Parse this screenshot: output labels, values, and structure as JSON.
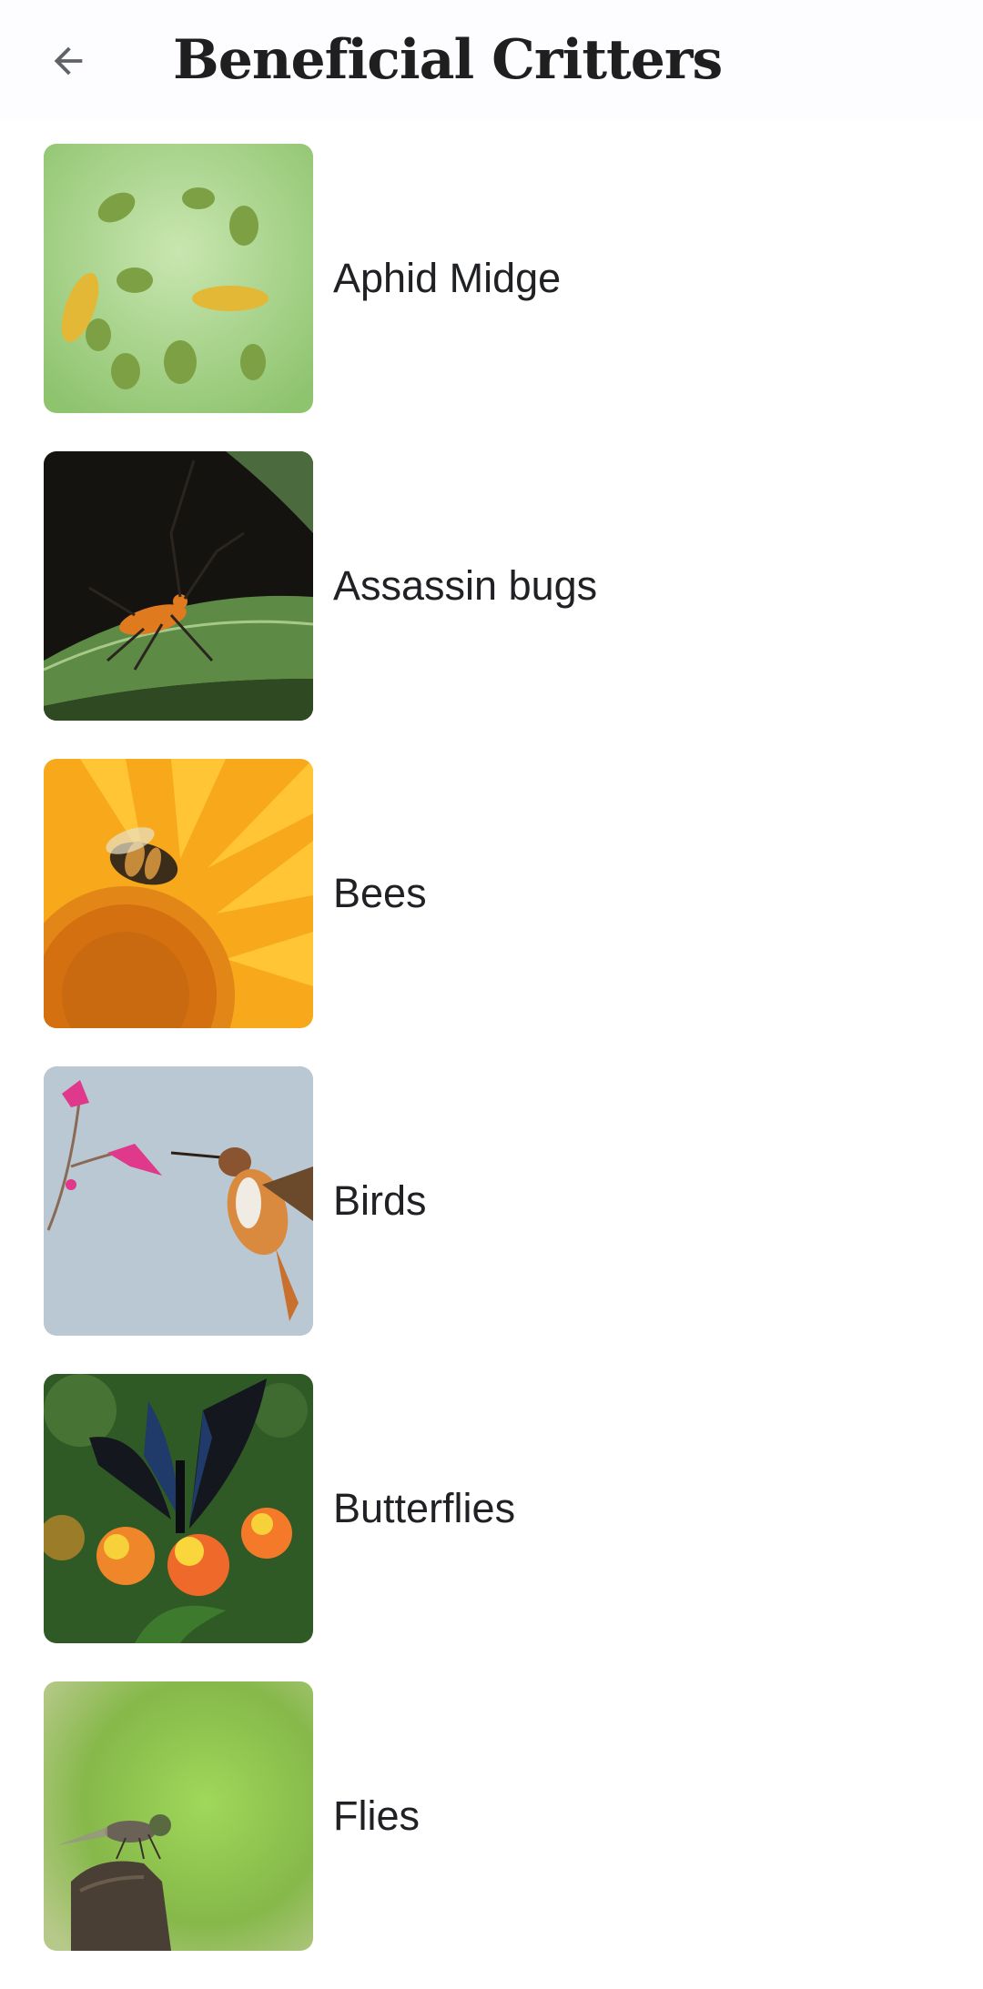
{
  "app_bar": {
    "back_icon": "arrow-back-icon",
    "title": "Beneficial Critters"
  },
  "critters": [
    {
      "name": "Aphid Midge",
      "image": "aphid-midge-photo"
    },
    {
      "name": "Assassin bugs",
      "image": "assassin-bug-photo"
    },
    {
      "name": "Bees",
      "image": "bee-on-sunflower-photo"
    },
    {
      "name": "Birds",
      "image": "hummingbird-photo"
    },
    {
      "name": "Butterflies",
      "image": "butterfly-on-lantana-photo"
    },
    {
      "name": "Flies",
      "image": "robber-fly-photo"
    }
  ],
  "colors": {
    "background": "#ffffff",
    "text": "#202124",
    "icon": "#5f6368"
  }
}
